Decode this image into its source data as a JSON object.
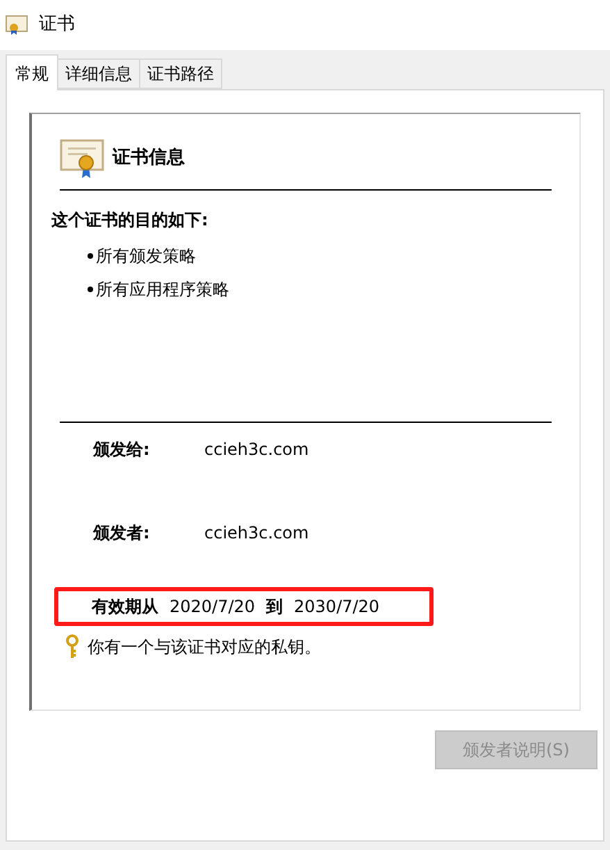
{
  "window": {
    "title": "证书"
  },
  "tabs": [
    {
      "label": "常规",
      "selected": true
    },
    {
      "label": "详细信息",
      "selected": false
    },
    {
      "label": "证书路径",
      "selected": false
    }
  ],
  "info": {
    "heading": "证书信息",
    "purpose_title": "这个证书的目的如下:",
    "purposes": [
      "所有颁发策略",
      "所有应用程序策略"
    ],
    "issued_to": {
      "label": "颁发给:",
      "value": "ccieh3c.com"
    },
    "issued_by": {
      "label": "颁发者:",
      "value": "ccieh3c.com"
    },
    "validity": {
      "from_label": "有效期从",
      "from": "2020/7/20",
      "to_label": "到",
      "to": "2030/7/20",
      "highlighted": true
    },
    "private_key_note": "你有一个与该证书对应的私钥。"
  },
  "buttons": [
    {
      "label": "颁发者说明(S)",
      "disabled": true
    }
  ]
}
